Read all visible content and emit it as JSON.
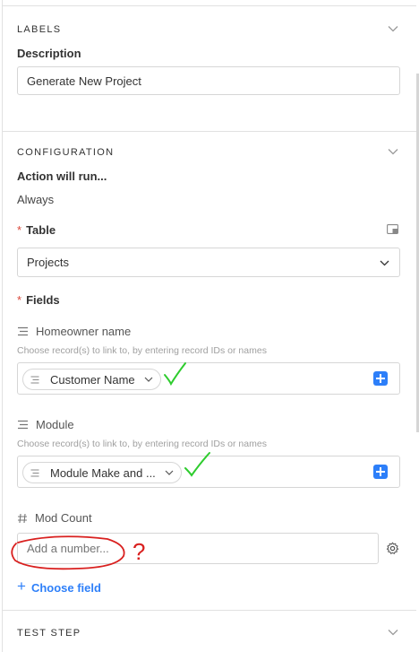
{
  "labels_section": {
    "header": "LABELS",
    "description_label": "Description",
    "description_value": "Generate New Project"
  },
  "configuration_section": {
    "header": "CONFIGURATION",
    "action_label": "Action will run...",
    "action_value": "Always",
    "required_marker": "*",
    "table_label": "Table",
    "table_value": "Projects",
    "fields_label": "Fields",
    "fields": [
      {
        "name": "Homeowner name",
        "hint": "Choose record(s) to link to, by entering record IDs or names",
        "pill_value": "Customer Name"
      },
      {
        "name": "Module",
        "hint": "Choose record(s) to link to, by entering record IDs or names",
        "pill_value": "Module Make and ..."
      }
    ],
    "mod_count_label": "Mod Count",
    "mod_count_placeholder": "Add a number...",
    "choose_field_label": "Choose field",
    "choose_field_plus": "+"
  },
  "test_step_section": {
    "header": "TEST STEP"
  },
  "annotations": {
    "question_mark": "?"
  },
  "colors": {
    "accent_blue": "#2d7ff9",
    "required_red": "#d9473a",
    "check_green": "#2ecc2e",
    "annotation_red": "#d9201f"
  },
  "icons": [
    "chevron-down-icon",
    "layout-icon",
    "linked-record-icon",
    "number-icon",
    "gear-icon",
    "plus-icon"
  ]
}
